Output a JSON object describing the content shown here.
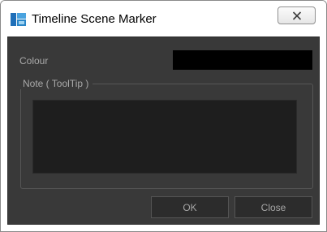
{
  "window": {
    "title": "Timeline Scene Marker",
    "app_icon": "timeline-app-icon",
    "close_icon": "close-x-icon"
  },
  "form": {
    "colour_label": "Colour",
    "colour_value": "#000000",
    "note_label": "Note ( ToolTip )",
    "note_value": ""
  },
  "buttons": {
    "ok_label": "OK",
    "close_label": "Close"
  },
  "colors": {
    "panel_bg": "#393939",
    "field_bg": "#1e1e1e",
    "button_bg": "#2c2c2c",
    "label_text": "#a9a9a9"
  }
}
